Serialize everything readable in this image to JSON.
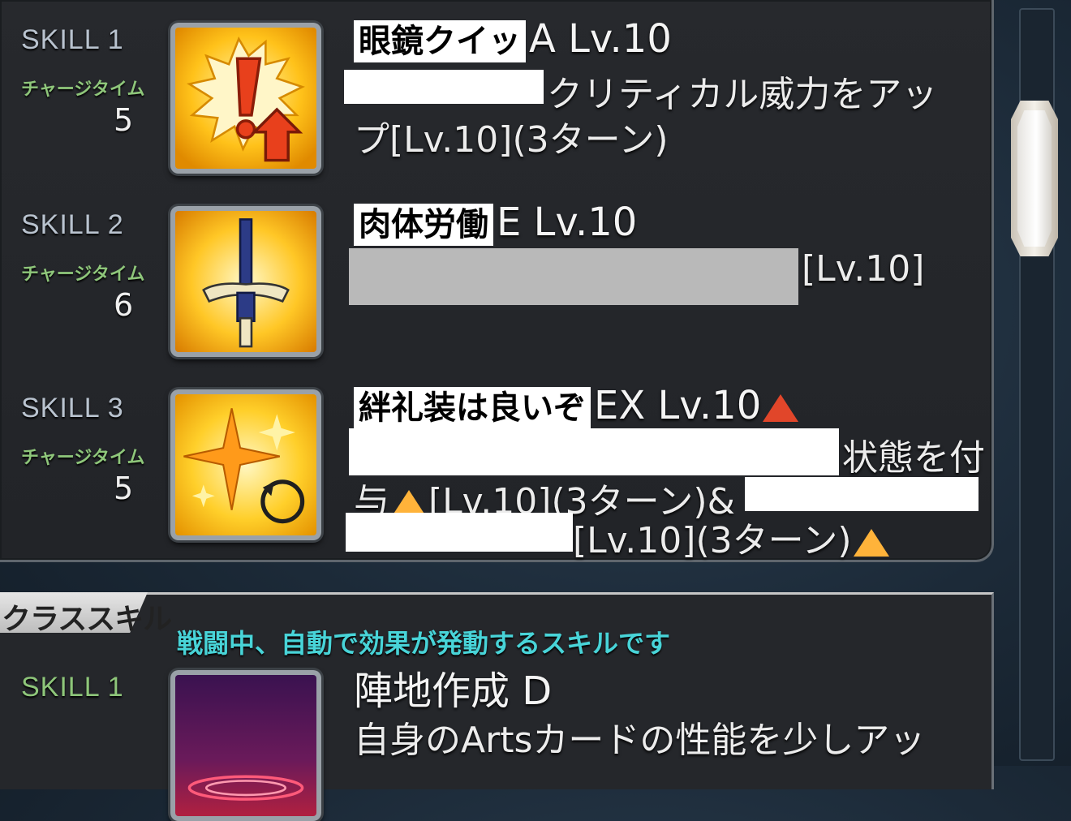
{
  "skills": [
    {
      "label": "SKILL 1",
      "charge_label": "チャージタイム",
      "charge": "5",
      "name_redacted": "眼鏡クイッ",
      "name_suffix": "A Lv.10",
      "desc_line1": "クリティカル威力をアッ",
      "desc_line2": "プ[Lv.10](3ターン)",
      "icon": "critical-exclamation-up-icon"
    },
    {
      "label": "SKILL 2",
      "charge_label": "チャージタイム",
      "charge": "6",
      "name_redacted": "肉体労働",
      "name_suffix": "E Lv.10",
      "desc_line1": "[Lv.10]",
      "icon": "sword-icon"
    },
    {
      "label": "SKILL 3",
      "charge_label": "チャージタイム",
      "charge": "5",
      "name_redacted": "絆礼装は良いぞ",
      "name_suffix": "EX Lv.10",
      "desc_line1": "状態を付",
      "desc_line2a": "与",
      "desc_line2b": "[Lv.10](3ターン)&",
      "desc_line3": "[Lv.10](3ターン)",
      "icon": "sparkle-refresh-icon"
    }
  ],
  "class_skills": {
    "title": "クラススキル",
    "subtitle": "戦闘中、自動で効果が発動するスキルです",
    "items": [
      {
        "label": "SKILL 1",
        "name": "陣地作成 D",
        "desc_line1": "自身のArtsカードの性能を少しアッ",
        "icon": "territory-creation-icon"
      }
    ]
  },
  "colors": {
    "panel": "#27292d",
    "charge_text": "#8ec67a",
    "subtitle": "#48d4d8",
    "upgrade_triangle": "#ffb33a"
  }
}
